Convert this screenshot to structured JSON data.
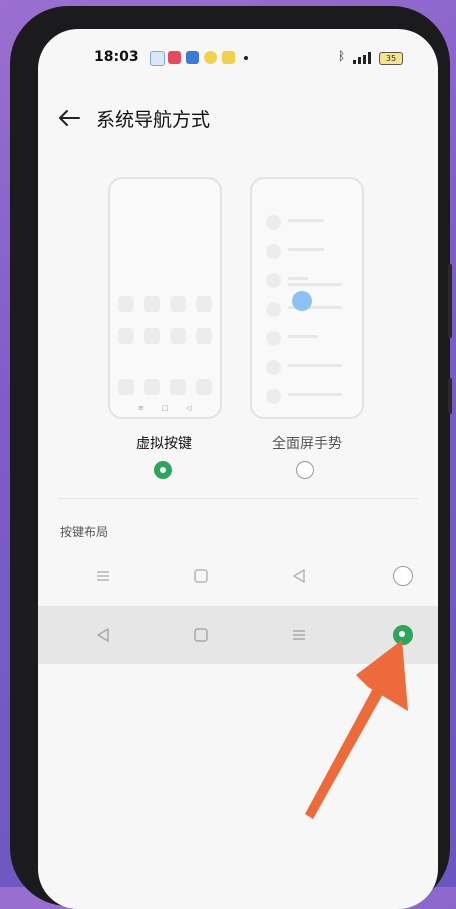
{
  "status_bar": {
    "time": "18:03",
    "battery": "35",
    "icons": [
      "app-notify-icon",
      "red-app-icon",
      "blue-app-icon",
      "weibo-icon",
      "yellow-app-icon",
      "bluetooth-icon",
      "signal-icon",
      "battery-icon"
    ]
  },
  "header": {
    "title": "系统导航方式",
    "back_icon": "back-arrow-icon"
  },
  "options": [
    {
      "label": "虚拟按键",
      "selected": true
    },
    {
      "label": "全面屏手势",
      "selected": false
    }
  ],
  "section": {
    "label": "按键布局"
  },
  "layouts": [
    {
      "icons": [
        "menu-icon",
        "home-square-icon",
        "back-triangle-icon"
      ],
      "selected": false
    },
    {
      "icons": [
        "back-triangle-icon",
        "home-square-icon",
        "menu-icon"
      ],
      "selected": true
    }
  ],
  "colors": {
    "accent": "#2ea55a",
    "arrow": "#ee6a3a"
  }
}
